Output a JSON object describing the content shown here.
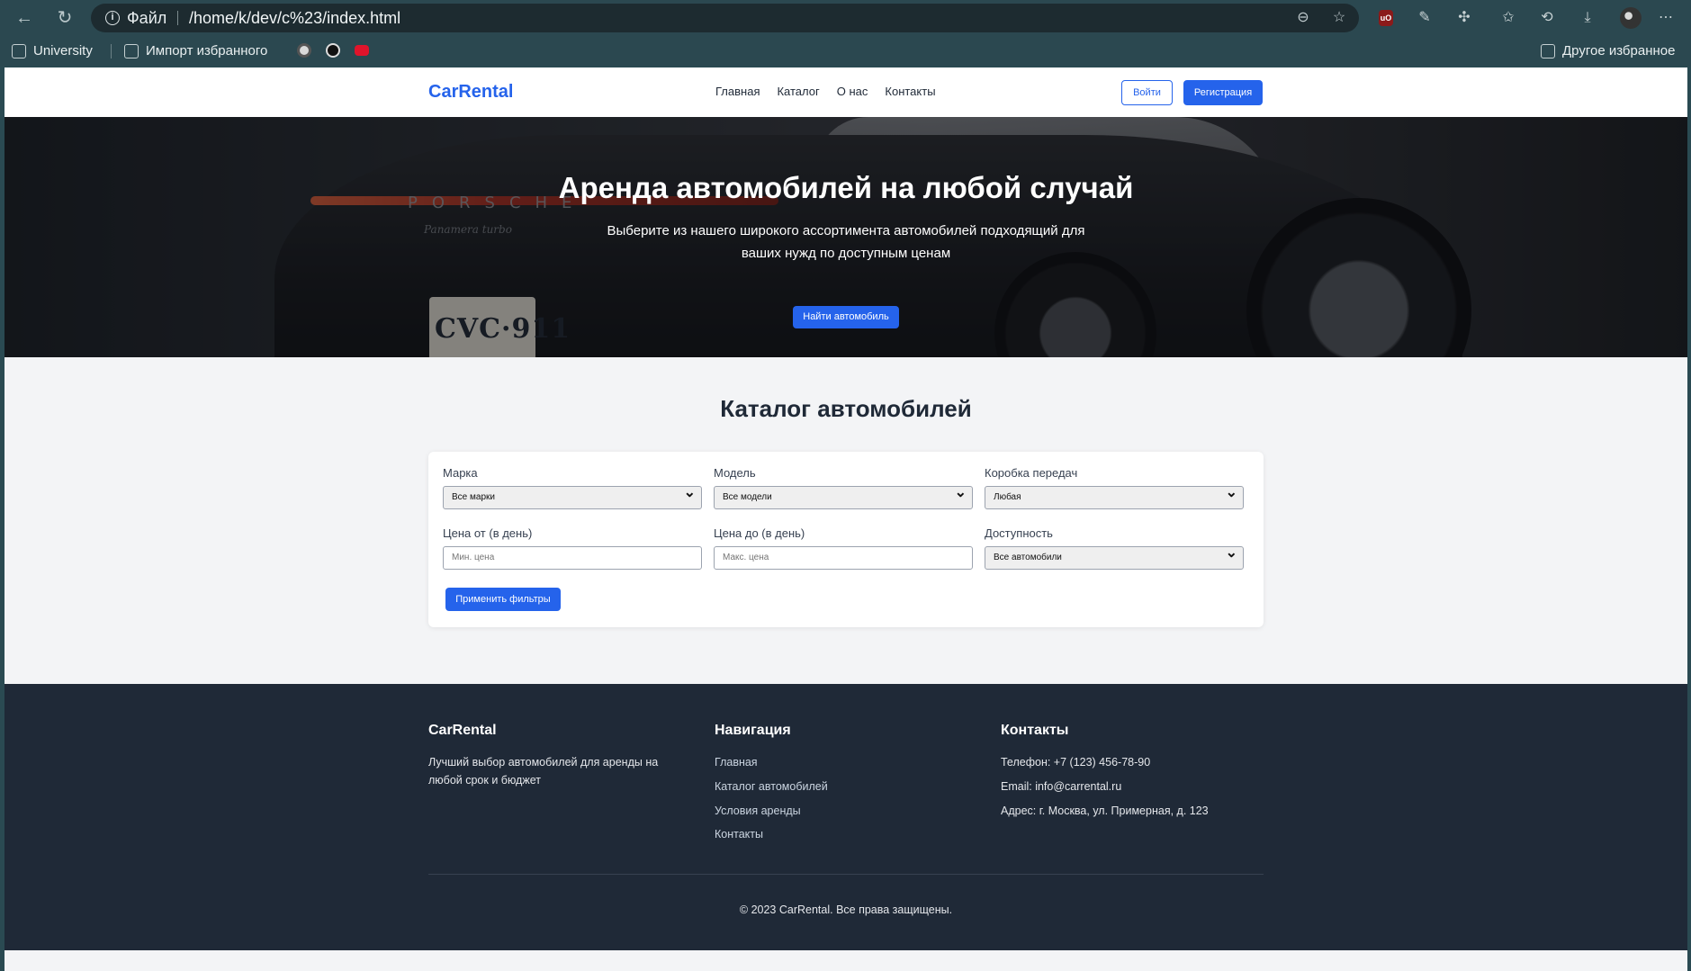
{
  "browser": {
    "address_file_label": "Файл",
    "address_url": "/home/k/dev/c%23/index.html",
    "bookmarks": {
      "university": "University",
      "import": "Импорт избранного",
      "other": "Другое избранное"
    }
  },
  "site": {
    "logo": "CarRental",
    "nav": [
      "Главная",
      "Каталог",
      "О нас",
      "Контакты"
    ],
    "login": "Войти",
    "register": "Регистрация"
  },
  "hero": {
    "title": "Аренда автомобилей на любой случай",
    "subtitle": "Выберите из нашего широкого ассортимента автомобилей подходящий для ваших нужд по доступным ценам",
    "cta": "Найти автомобиль",
    "image_text": {
      "brand": "PORSCHE",
      "model": "Panamera turbo",
      "plate": "CVC·911"
    }
  },
  "catalog": {
    "title": "Каталог автомобилей",
    "filters": {
      "brand_label": "Марка",
      "brand_value": "Все марки",
      "model_label": "Модель",
      "model_value": "Все модели",
      "gearbox_label": "Коробка передач",
      "gearbox_value": "Любая",
      "price_from_label": "Цена от (в день)",
      "price_from_placeholder": "Мин. цена",
      "price_to_label": "Цена до (в день)",
      "price_to_placeholder": "Макс. цена",
      "availability_label": "Доступность",
      "availability_value": "Все автомобили",
      "apply": "Применить фильтры"
    }
  },
  "footer": {
    "about_title": "CarRental",
    "about_text": "Лучший выбор автомобилей для аренды на любой срок и бюджет",
    "nav_title": "Навигация",
    "nav_links": [
      "Главная",
      "Каталог автомобилей",
      "Условия аренды",
      "Контакты"
    ],
    "contacts_title": "Контакты",
    "phone": "Телефон: +7 (123) 456-78-90",
    "email": "Email: info@carrental.ru",
    "address": "Адрес: г. Москва, ул. Примерная, д. 123",
    "copyright": "© 2023 CarRental. Все права защищены."
  },
  "colors": {
    "accent": "#2563eb",
    "footer_bg": "#1f2937",
    "page_bg": "#f3f4f6",
    "chrome_bg": "#2b4850"
  }
}
